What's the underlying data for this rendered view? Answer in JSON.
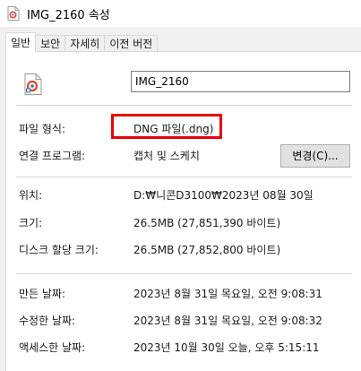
{
  "window": {
    "title": "IMG_2160 속성"
  },
  "tabs": [
    {
      "label": "일반",
      "active": true
    },
    {
      "label": "보안",
      "active": false
    },
    {
      "label": "자세히",
      "active": false
    },
    {
      "label": "이전 버전",
      "active": false
    }
  ],
  "general": {
    "file_name": "IMG_2160",
    "file_type_label": "파일 형식:",
    "file_type_value": "DNG 파일(.dng)",
    "open_with_label": "연결 프로그램:",
    "open_with_value": "캡처 및 스케치",
    "change_button": "변경(C)...",
    "location_label": "위치:",
    "location_value": "D:₩니콘D3100₩2023년 08월 30일",
    "size_label": "크기:",
    "size_value": "26.5MB (27,851,390 바이트)",
    "size_on_disk_label": "디스크 할당 크기:",
    "size_on_disk_value": "26.5MB (27,852,800 바이트)",
    "created_label": "만든 날짜:",
    "created_value": "2023년 8월 31일 목요일, 오전 9:08:31",
    "modified_label": "수정한 날짜:",
    "modified_value": "2023년 8월 31일 목요일, 오전 9:08:32",
    "accessed_label": "액세스한 날짜:",
    "accessed_value": "2023년 10월 30일 오늘, 오후 5:15:11"
  },
  "colors": {
    "highlight": "#e8000b",
    "panel_bg": "#ffffff",
    "window_bg": "#f0f0f0"
  },
  "icons": {
    "title": "dng-file-icon",
    "file": "dng-file-icon"
  }
}
